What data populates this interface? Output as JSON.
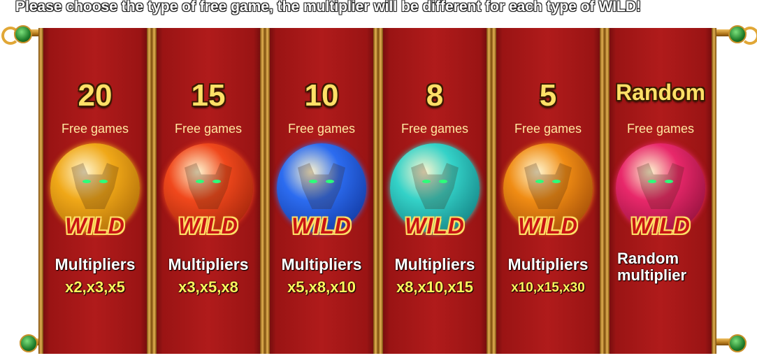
{
  "instruction": "Please choose the type of free game, the multiplier will be different for each type of WILD!",
  "options": [
    {
      "count": "20",
      "free_label": "Free games",
      "wild": "WILD",
      "mult_label": "Multipliers",
      "multipliers": "x2,x3,x5",
      "orb_color": "#f0a818",
      "orb_shade": "#9a5a04"
    },
    {
      "count": "15",
      "free_label": "Free games",
      "wild": "WILD",
      "mult_label": "Multipliers",
      "multipliers": "x3,x5,x8",
      "orb_color": "#f0481c",
      "orb_shade": "#8a1a06"
    },
    {
      "count": "10",
      "free_label": "Free games",
      "wild": "WILD",
      "mult_label": "Multipliers",
      "multipliers": "x5,x8,x10",
      "orb_color": "#2c6cf0",
      "orb_shade": "#0a2a8a"
    },
    {
      "count": "8",
      "free_label": "Free games",
      "wild": "WILD",
      "mult_label": "Multipliers",
      "multipliers": "x8,x10,x15",
      "orb_color": "#34d2c8",
      "orb_shade": "#0a6a70"
    },
    {
      "count": "5",
      "free_label": "Free games",
      "wild": "WILD",
      "mult_label": "Multipliers",
      "multipliers": "x10,x15,x30",
      "orb_color": "#f08c14",
      "orb_shade": "#8a3a04"
    },
    {
      "count": "Random",
      "free_label": "Free games",
      "wild": "WILD",
      "mult_label": "Random multiplier",
      "multipliers": "",
      "orb_color": "#e8286a",
      "orb_shade": "#7a0a30"
    }
  ]
}
